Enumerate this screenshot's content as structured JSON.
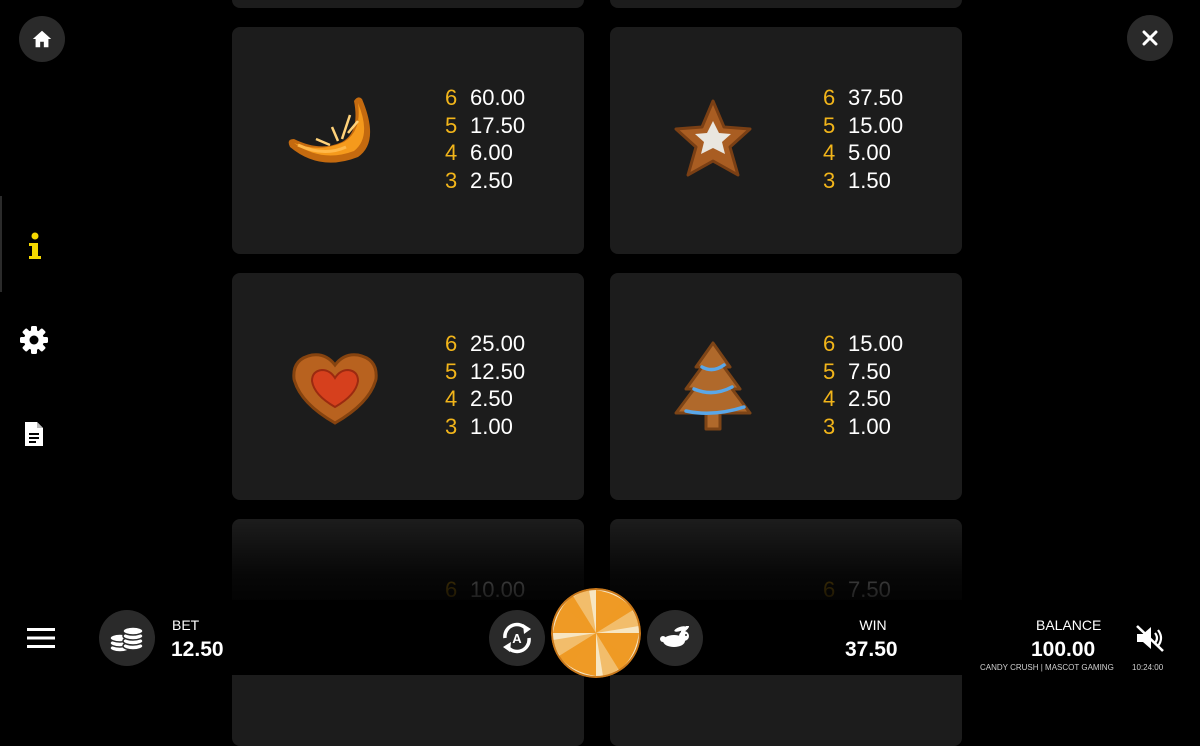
{
  "colors": {
    "accent": "#f2b51a",
    "card": "#1c1c1c",
    "button": "#2a2a2a"
  },
  "nav": {
    "home_icon": "home-icon",
    "close_icon": "close-icon",
    "side_items": [
      "info-icon",
      "gear-icon",
      "document-icon"
    ]
  },
  "paytable": [
    {
      "symbol": "orange-slice-candy",
      "pays": [
        {
          "count": "6",
          "amount": "60.00"
        },
        {
          "count": "5",
          "amount": "17.50"
        },
        {
          "count": "4",
          "amount": "6.00"
        },
        {
          "count": "3",
          "amount": "2.50"
        }
      ]
    },
    {
      "symbol": "star-cookie",
      "pays": [
        {
          "count": "6",
          "amount": "37.50"
        },
        {
          "count": "5",
          "amount": "15.00"
        },
        {
          "count": "4",
          "amount": "5.00"
        },
        {
          "count": "3",
          "amount": "1.50"
        }
      ]
    },
    {
      "symbol": "heart-jam-cookie",
      "pays": [
        {
          "count": "6",
          "amount": "25.00"
        },
        {
          "count": "5",
          "amount": "12.50"
        },
        {
          "count": "4",
          "amount": "2.50"
        },
        {
          "count": "3",
          "amount": "1.00"
        }
      ]
    },
    {
      "symbol": "tree-gingerbread-cookie",
      "pays": [
        {
          "count": "6",
          "amount": "15.00"
        },
        {
          "count": "5",
          "amount": "7.50"
        },
        {
          "count": "4",
          "amount": "2.50"
        },
        {
          "count": "3",
          "amount": "1.00"
        }
      ]
    },
    {
      "symbol": "cookie-partial",
      "pays": [
        {
          "count": "6",
          "amount": "10.00"
        }
      ]
    },
    {
      "symbol": "cookie-partial",
      "pays": [
        {
          "count": "6",
          "amount": "7.50"
        }
      ]
    }
  ],
  "bottom": {
    "bet_label": "BET",
    "bet_value": "12.50",
    "win_label": "WIN",
    "win_value": "37.50",
    "balance_label": "BALANCE",
    "balance_value": "100.00",
    "brand": "CANDY CRUSH | MASCOT GAMING",
    "time": "10:24:00"
  }
}
